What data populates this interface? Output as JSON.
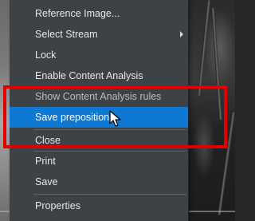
{
  "context_menu": {
    "items": [
      {
        "label": "Reference Image...",
        "has_submenu": false,
        "state": "normal"
      },
      {
        "label": "Select Stream",
        "has_submenu": true,
        "state": "normal"
      },
      {
        "label": "Lock",
        "has_submenu": false,
        "state": "normal"
      },
      {
        "label": "Enable Content Analysis",
        "has_submenu": false,
        "state": "normal"
      },
      {
        "label": "Show Content Analysis rules",
        "has_submenu": false,
        "state": "disabled"
      },
      {
        "label": "Save preposition",
        "has_submenu": false,
        "state": "highlighted"
      },
      {
        "label": "Close",
        "has_submenu": false,
        "state": "normal"
      },
      {
        "label": "Print",
        "has_submenu": false,
        "state": "normal"
      },
      {
        "label": "Save",
        "has_submenu": false,
        "state": "normal"
      },
      {
        "label": "Properties",
        "has_submenu": false,
        "state": "normal"
      }
    ]
  },
  "annotation": {
    "color": "#e10000"
  },
  "colors": {
    "menu_background": "#3c4245",
    "highlight": "#0f78d2",
    "text": "#e6e8ea"
  },
  "icons": {
    "submenu": "chevron-right-icon",
    "pointer": "mouse-pointer-icon"
  }
}
